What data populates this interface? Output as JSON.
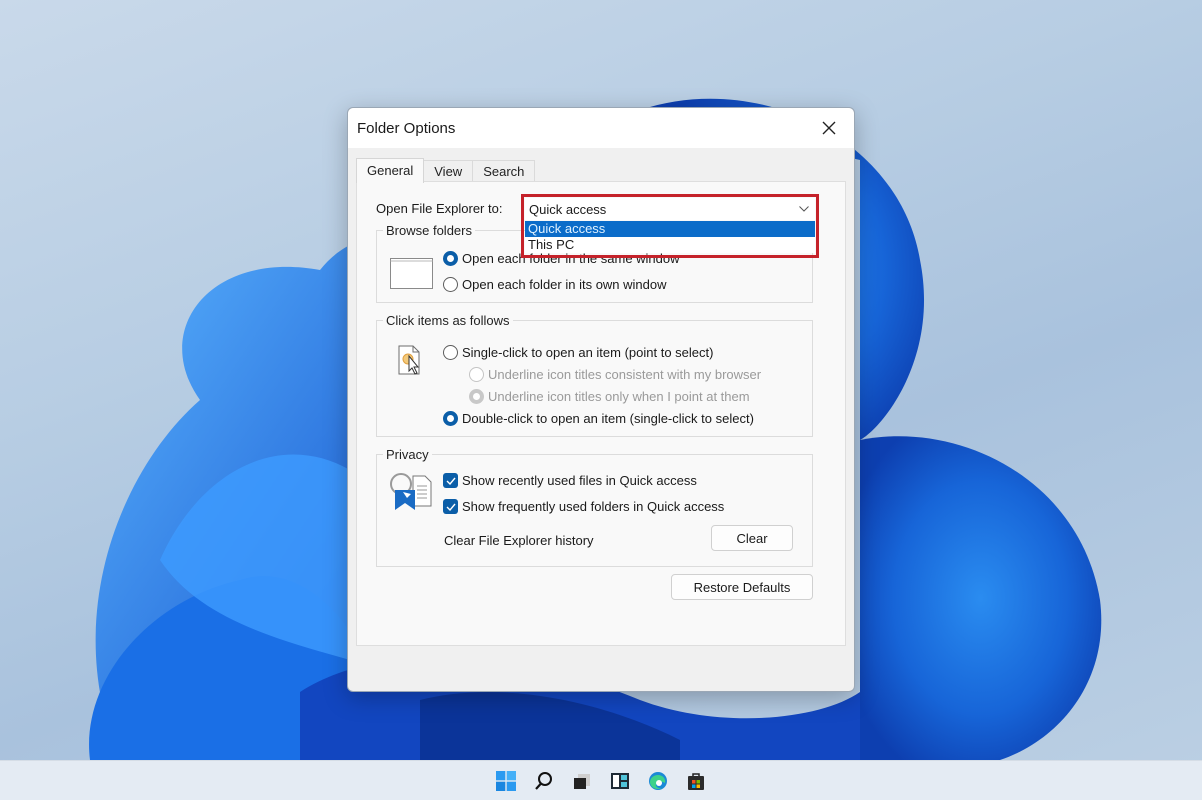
{
  "dialog": {
    "title": "Folder Options",
    "tabs": [
      {
        "label": "General",
        "active": true
      },
      {
        "label": "View",
        "active": false
      },
      {
        "label": "Search",
        "active": false
      }
    ],
    "open_explorer": {
      "label": "Open File Explorer to:",
      "selected": "Quick access",
      "options": [
        {
          "label": "Quick access",
          "highlighted": true
        },
        {
          "label": "This PC",
          "highlighted": false
        }
      ],
      "highlight_color": "#c5222a"
    },
    "browse_folders": {
      "title": "Browse folders",
      "options": [
        {
          "label": "Open each folder in the same window",
          "checked": true
        },
        {
          "label": "Open each folder in its own window",
          "checked": false
        }
      ]
    },
    "click_items": {
      "title": "Click items as follows",
      "single_click": {
        "label": "Single-click to open an item (point to select)",
        "checked": false
      },
      "underline_browser": {
        "label": "Underline icon titles consistent with my browser",
        "checked": false,
        "disabled": true
      },
      "underline_point": {
        "label": "Underline icon titles only when I point at them",
        "checked": true,
        "disabled": true
      },
      "double_click": {
        "label": "Double-click to open an item (single-click to select)",
        "checked": true
      }
    },
    "privacy": {
      "title": "Privacy",
      "recent_files": {
        "label": "Show recently used files in Quick access",
        "checked": true
      },
      "frequent_folders": {
        "label": "Show frequently used folders in Quick access",
        "checked": true
      },
      "clear_history_label": "Clear File Explorer history",
      "clear_button": "Clear"
    },
    "restore_defaults": "Restore Defaults"
  },
  "taskbar": {
    "icons": [
      "start-icon",
      "search-icon",
      "task-view-icon",
      "widgets-icon",
      "edge-icon",
      "store-icon"
    ]
  },
  "colors": {
    "accent": "#0b5ea8",
    "selection": "#0b6cc9"
  }
}
